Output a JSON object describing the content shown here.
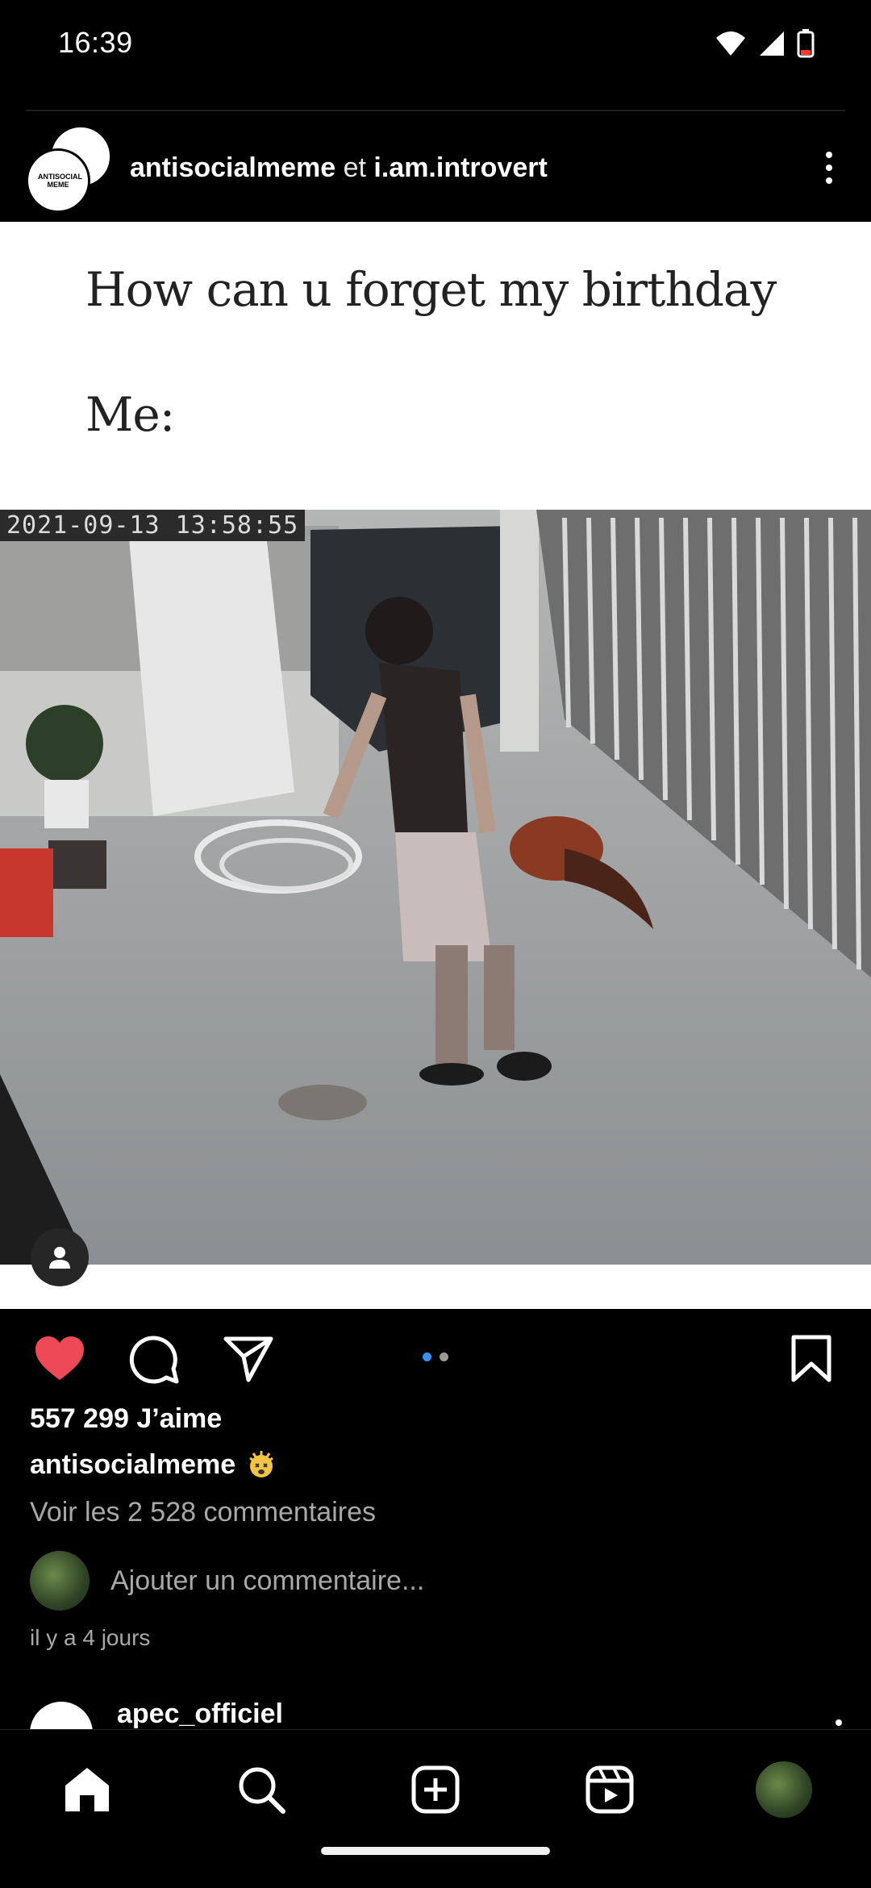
{
  "status_bar": {
    "time": "16:39",
    "icons": [
      "wifi-icon",
      "cellular-signal-icon",
      "battery-low-icon"
    ]
  },
  "post": {
    "author": "antisocialmeme",
    "connector": "et",
    "coauthor": "i.am.introvert",
    "author_avatar_text": "ANTISOCIAL MEME",
    "meme_line_1": "How can u forget my birthday",
    "meme_line_2": "Me:",
    "video_timestamp": "2021-09-13 13:58:55",
    "carousel": {
      "count": 2,
      "active_index": 0
    },
    "likes": "557 299 J’aime",
    "caption_user": "antisocialmeme",
    "caption_emoji": "dizzy-face-emoji",
    "view_comments": "Voir les 2 528 commentaires",
    "comment_placeholder": "Ajouter un commentaire...",
    "time_ago": "il y a 4 jours",
    "liked": true
  },
  "next_post": {
    "author": "apec_officiel"
  },
  "bottom_nav": {
    "items": [
      "home-icon",
      "search-icon",
      "create-post-icon",
      "reels-icon",
      "profile-avatar"
    ],
    "active": "home-icon"
  },
  "colors": {
    "background": "#000000",
    "like_red": "#ed4956",
    "carousel_active": "#3b8ef0",
    "secondary_text": "#a8a8a8"
  }
}
